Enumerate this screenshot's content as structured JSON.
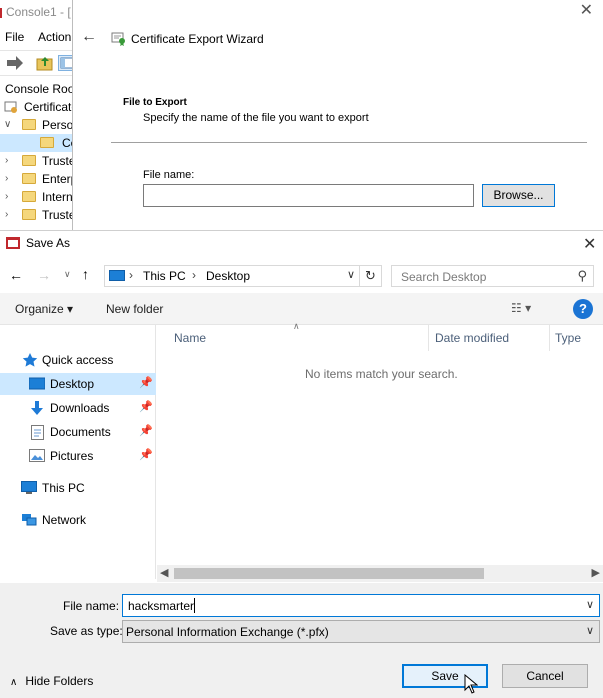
{
  "mmc": {
    "title": "Console1 - [",
    "menu": [
      "File",
      "Action"
    ],
    "tree": [
      {
        "label": "Console Root",
        "indent": 0
      },
      {
        "label": "Certificate",
        "indent": 0
      },
      {
        "label": "Perso",
        "indent": 1,
        "expanded": true
      },
      {
        "label": "Ce",
        "indent": 2,
        "selected": true
      },
      {
        "label": "Truste",
        "indent": 1
      },
      {
        "label": "Enterp",
        "indent": 1
      },
      {
        "label": "Intern",
        "indent": 1
      },
      {
        "label": "Truste",
        "indent": 1
      }
    ]
  },
  "wizard": {
    "title": "Certificate Export Wizard",
    "section_title": "File to Export",
    "section_desc": "Specify the name of the file you want to export",
    "file_name_label": "File name:",
    "file_name_value": "",
    "browse_label": "Browse..."
  },
  "saveas": {
    "title": "Save As",
    "address": [
      "This PC",
      "Desktop"
    ],
    "search_placeholder": "Search Desktop",
    "commands": {
      "organize": "Organize ▾",
      "new_folder": "New folder"
    },
    "nav_items": [
      {
        "label": "Quick access",
        "icon": "star-icon"
      },
      {
        "label": "Desktop",
        "icon": "desktop-icon",
        "pinned": true,
        "selected": true
      },
      {
        "label": "Downloads",
        "icon": "download-icon",
        "pinned": true
      },
      {
        "label": "Documents",
        "icon": "documents-icon",
        "pinned": true
      },
      {
        "label": "Pictures",
        "icon": "pictures-icon",
        "pinned": true
      },
      {
        "label": "This PC",
        "icon": "computer-icon"
      },
      {
        "label": "Network",
        "icon": "network-icon"
      }
    ],
    "columns": [
      "Name",
      "Date modified",
      "Type"
    ],
    "empty_message": "No items match your search.",
    "file_name_label": "File name:",
    "file_name_value": "hacksmarter",
    "save_type_label": "Save as type:",
    "save_type_value": "Personal Information Exchange (*.pfx)",
    "hide_folders": "Hide Folders",
    "save_button": "Save",
    "cancel_button": "Cancel"
  },
  "colors": {
    "accent": "#0078d7",
    "selected": "#cce8ff",
    "folder": "#f5d77c"
  }
}
